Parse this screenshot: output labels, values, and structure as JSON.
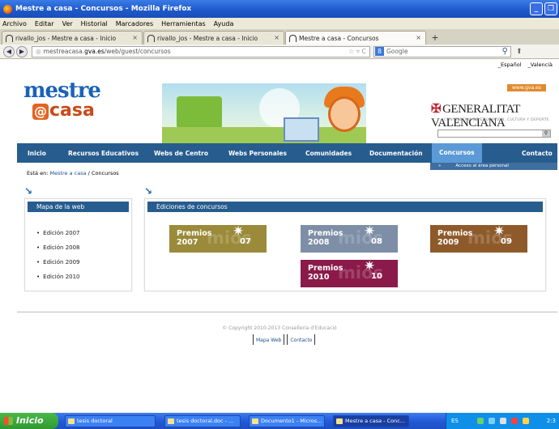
{
  "window": {
    "title": "Mestre a casa - Concursos - Mozilla Firefox",
    "menu": [
      "Archivo",
      "Editar",
      "Ver",
      "Historial",
      "Marcadores",
      "Herramientas",
      "Ayuda"
    ]
  },
  "tabs": [
    {
      "label": "rivallo_jos - Mestre a casa - Inicio"
    },
    {
      "label": "rivallo_jos - Mestre a casa - Inicio"
    },
    {
      "label": "Mestre a casa - Concursos"
    }
  ],
  "navbar": {
    "url_prefix": "mestreacasa.",
    "url_host": "gva.es",
    "url_path": "/web/guest/concursos",
    "search_placeholder": "Google"
  },
  "page": {
    "languages": [
      "_Español",
      "_Valencià"
    ],
    "logo_top": "mestre",
    "logo_bottom": "casa",
    "logo_at": "@",
    "gva_url": "www.gva.es",
    "gv_title": "GENERALITAT VALENCIANA",
    "gv_sub": "CONSELLERIA DE EDUCACIÓN, CULTURA Y DEPORTE",
    "nav": [
      "Inicio",
      "Recursos Educativos",
      "Webs de Centro",
      "Webs Personales",
      "Comunidades",
      "Documentación",
      "Concursos",
      "Contacto"
    ],
    "subnav": "Acceso al área personal",
    "breadcrumb_label": "Está en:",
    "breadcrumb_link": "Mestre a casa",
    "breadcrumb_sep": " / ",
    "breadcrumb_current": "Concursos",
    "sitemap": {
      "title": "Mapa de la web",
      "items": [
        "Edición 2007",
        "Edición 2008",
        "Edición 2009",
        "Edición 2010"
      ]
    },
    "editions": {
      "title": "Ediciones de concursos",
      "premios": [
        {
          "word": "Premios",
          "year": "2007",
          "short": "07",
          "ghost": "mios",
          "color": "#9a8a3a"
        },
        {
          "word": "Premios",
          "year": "2008",
          "short": "08",
          "ghost": "mios",
          "color": "#7d8ea6"
        },
        {
          "word": "Premios",
          "year": "2009",
          "short": "09",
          "ghost": "mios",
          "color": "#8e5a2a"
        },
        {
          "word": "Premios",
          "year": "2010",
          "short": "10",
          "ghost": "mios",
          "color": "#8a1a4a"
        }
      ]
    },
    "copyright": "© Copyright 2010-2013 Conselleria d'Educació",
    "footer_links": [
      "Mapa Web",
      "Contacto"
    ]
  },
  "taskbar": {
    "start": "Inicio",
    "items": [
      "tesis doctoral",
      "tesis doctoral.doc - ...",
      "Documento1 - Micros...",
      "Mestre a casa - Conc..."
    ],
    "lang": "ES",
    "clock": "2:3"
  }
}
